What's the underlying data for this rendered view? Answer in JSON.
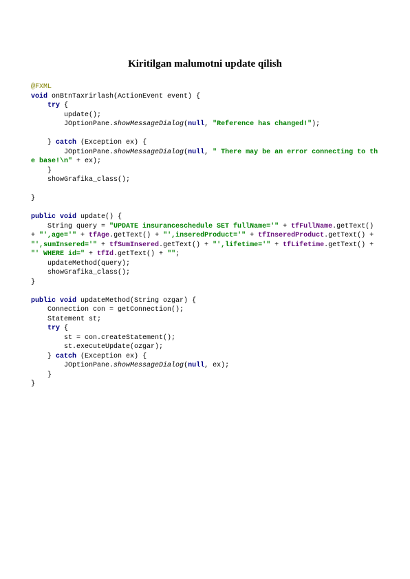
{
  "title": "Kiritilgan malumotni update qilish",
  "code": {
    "anno_fxml": "@FXML",
    "kw_void1": "void",
    "txt_method1_sig": " onBtnTaxrirlash(ActionEvent event) {",
    "ind1": "    ",
    "kw_try1": "try",
    "txt_try1_open": " {",
    "txt_update_call": "        update();",
    "txt_jopt1_pre": "        JOptionPane.",
    "txt_jopt1_meth": "showMessageDialog",
    "txt_jopt1_open": "(",
    "kw_null1": "null",
    "txt_jopt1_comma": ", ",
    "str_ref_changed": "\"Reference has changed!\"",
    "txt_jopt1_close": ");",
    "txt_blank": "",
    "txt_catch1_pre": "    } ",
    "kw_catch1": "catch",
    "txt_catch1_post": " (Exception ex) {",
    "txt_jopt2_pre": "        JOptionPane.",
    "txt_jopt2_meth": "showMessageDialog",
    "txt_jopt2_open": "(",
    "kw_null2": "null",
    "txt_jopt2_comma": ", ",
    "str_error1": "\" There may be an error connecting to the base!\\n\"",
    "txt_jopt2_close": " + ex);",
    "txt_rb1": "    }",
    "txt_showgraf1": "    showGrafika_class();",
    "txt_rb2": "}",
    "kw_public1": "public void",
    "txt_method2_sig": " update() {",
    "txt_query_pre": "    String query = ",
    "str_q1": "\"UPDATE insuranceschedule SET fullName='\"",
    "txt_plus1": " + ",
    "fld_fullname": "tfFullName",
    "txt_gettext1": ".getText() + ",
    "str_q2": "\"',age='\"",
    "txt_plus2": " + ",
    "fld_age": "tfAge",
    "txt_gettext2": ".getText() + ",
    "str_q3": "\"',inseredProduct='\"",
    "txt_plus3": " + ",
    "fld_insprod": "tfInseredProduct",
    "txt_gettext3": ".getText() + ",
    "str_q4": "\"',sumInsered='\"",
    "txt_plus4": " + ",
    "fld_suminsered": "tfSumInsered",
    "txt_gettext4": ".getText() + ",
    "str_q5": "\"',lifetime='\"",
    "txt_plus5": " + ",
    "fld_lifetime": "tfLifetime",
    "txt_gettext5": ".getText() + ",
    "str_q6": "\"' WHERE id=\"",
    "txt_plus6": " + ",
    "fld_id": "tfId",
    "txt_gettext6": ".getText() + ",
    "str_q7": "\"\"",
    "txt_semicolon": ";",
    "txt_updmethod": "    updateMethod(query);",
    "txt_showgraf2": "    showGrafika_class();",
    "txt_rb3": "}",
    "kw_public2": "public void",
    "txt_method3_sig": " updateMethod(String ozgar) {",
    "txt_conn": "    Connection con = getConnection();",
    "txt_stmt": "    Statement st;",
    "txt_ind2": "    ",
    "kw_try2": "try",
    "txt_try2_open": " {",
    "txt_st_create": "        st = con.createStatement();",
    "txt_st_exec": "        st.executeUpdate(ozgar);",
    "txt_catch2_pre": "    } ",
    "kw_catch2": "catch",
    "txt_catch2_post": " (Exception ex) {",
    "txt_jopt3_pre": "        JOptionPane.",
    "txt_jopt3_meth": "showMessageDialog",
    "txt_jopt3_open": "(",
    "kw_null3": "null",
    "txt_jopt3_close": ", ex);",
    "txt_rb4": "    }",
    "txt_rb5": "}"
  }
}
